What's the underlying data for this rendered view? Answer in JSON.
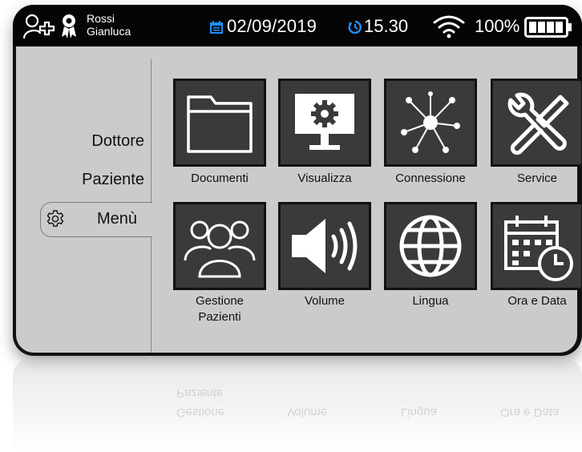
{
  "status": {
    "user_first": "Rossi",
    "user_last": "Gianluca",
    "date": "02/09/2019",
    "time": "15.30",
    "battery": "100%",
    "battery_level": 1.0,
    "icons": [
      "user-icon",
      "calendar-icon",
      "clock-icon",
      "wifi-icon",
      "battery-icon"
    ]
  },
  "sidebar": {
    "items": [
      {
        "label": "Dottore"
      },
      {
        "label": "Paziente"
      },
      {
        "label": "Menù",
        "icon": "gear-icon",
        "active": true
      }
    ]
  },
  "tiles": [
    {
      "label": "Documenti",
      "icon": "folder-icon"
    },
    {
      "label": "Visualizza",
      "icon": "monitor-gear-icon"
    },
    {
      "label": "Connessione",
      "icon": "network-icon"
    },
    {
      "label": "Service",
      "icon": "tools-icon"
    },
    {
      "label": "Gestione Pazienti",
      "icon": "users-icon"
    },
    {
      "label": "Volume",
      "icon": "speaker-icon"
    },
    {
      "label": "Lingua",
      "icon": "globe-icon"
    },
    {
      "label": "Ora e Data",
      "icon": "calendar-clock-icon"
    }
  ],
  "reflection": {
    "items": [
      "Paziente",
      "Gestione",
      "Volume",
      "Lingua",
      "Ora e Data"
    ]
  },
  "colors": {
    "statusbar": "#050505",
    "screen": "#cbcbcb",
    "tile": "#3a3a3a",
    "accent_blue": "#1e90ff"
  }
}
